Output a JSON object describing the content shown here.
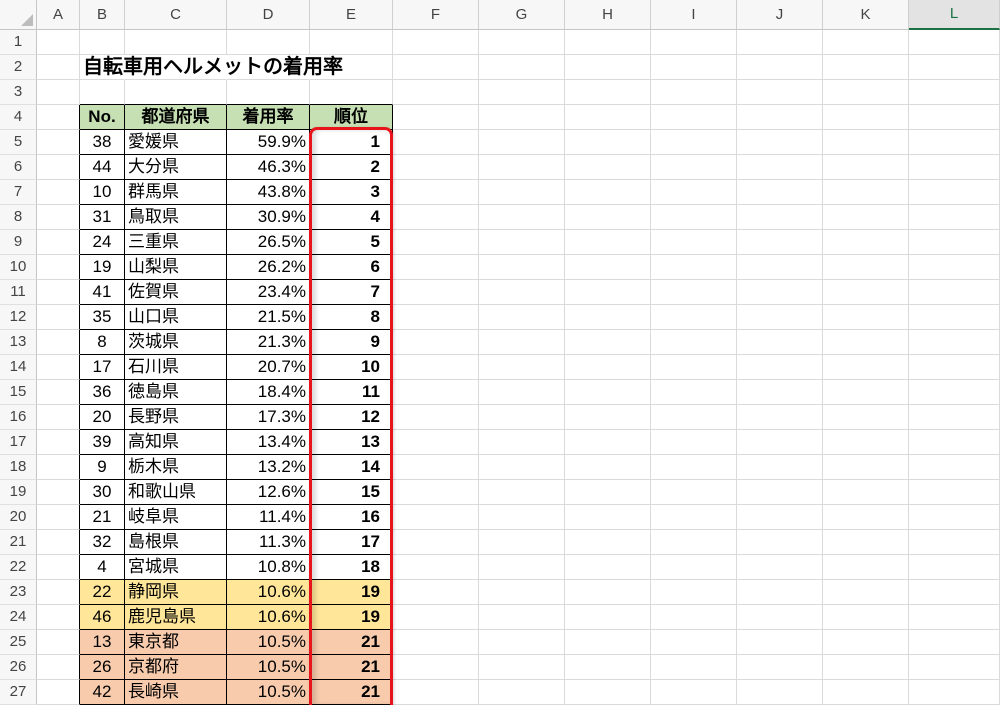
{
  "sheet": {
    "columns": [
      {
        "label": "A"
      },
      {
        "label": "B"
      },
      {
        "label": "C"
      },
      {
        "label": "D"
      },
      {
        "label": "E"
      },
      {
        "label": "F"
      },
      {
        "label": "G"
      },
      {
        "label": "H"
      },
      {
        "label": "I"
      },
      {
        "label": "J"
      },
      {
        "label": "K"
      },
      {
        "label": "L",
        "selected": true
      }
    ],
    "row_numbers": [
      1,
      2,
      3,
      4,
      5,
      6,
      7,
      8,
      9,
      10,
      11,
      12,
      13,
      14,
      15,
      16,
      17,
      18,
      19,
      20,
      21,
      22,
      23,
      24,
      25,
      26,
      27
    ],
    "title": "自転車用ヘルメットの着用率",
    "table": {
      "header": {
        "no": "No.",
        "prefecture": "都道府県",
        "rate": "着用率",
        "rank": "順位"
      },
      "rows": [
        {
          "no": 38,
          "prefecture": "愛媛県",
          "rate": "59.9%",
          "rank": 1
        },
        {
          "no": 44,
          "prefecture": "大分県",
          "rate": "46.3%",
          "rank": 2
        },
        {
          "no": 10,
          "prefecture": "群馬県",
          "rate": "43.8%",
          "rank": 3
        },
        {
          "no": 31,
          "prefecture": "鳥取県",
          "rate": "30.9%",
          "rank": 4
        },
        {
          "no": 24,
          "prefecture": "三重県",
          "rate": "26.5%",
          "rank": 5
        },
        {
          "no": 19,
          "prefecture": "山梨県",
          "rate": "26.2%",
          "rank": 6
        },
        {
          "no": 41,
          "prefecture": "佐賀県",
          "rate": "23.4%",
          "rank": 7
        },
        {
          "no": 35,
          "prefecture": "山口県",
          "rate": "21.5%",
          "rank": 8
        },
        {
          "no": 8,
          "prefecture": "茨城県",
          "rate": "21.3%",
          "rank": 9
        },
        {
          "no": 17,
          "prefecture": "石川県",
          "rate": "20.7%",
          "rank": 10
        },
        {
          "no": 36,
          "prefecture": "徳島県",
          "rate": "18.4%",
          "rank": 11
        },
        {
          "no": 20,
          "prefecture": "長野県",
          "rate": "17.3%",
          "rank": 12
        },
        {
          "no": 39,
          "prefecture": "高知県",
          "rate": "13.4%",
          "rank": 13
        },
        {
          "no": 9,
          "prefecture": "栃木県",
          "rate": "13.2%",
          "rank": 14
        },
        {
          "no": 30,
          "prefecture": "和歌山県",
          "rate": "12.6%",
          "rank": 15
        },
        {
          "no": 21,
          "prefecture": "岐阜県",
          "rate": "11.4%",
          "rank": 16
        },
        {
          "no": 32,
          "prefecture": "島根県",
          "rate": "11.3%",
          "rank": 17
        },
        {
          "no": 4,
          "prefecture": "宮城県",
          "rate": "10.8%",
          "rank": 18
        },
        {
          "no": 22,
          "prefecture": "静岡県",
          "rate": "10.6%",
          "rank": 19,
          "fill": "#FFE699"
        },
        {
          "no": 46,
          "prefecture": "鹿児島県",
          "rate": "10.6%",
          "rank": 19,
          "fill": "#FFE699"
        },
        {
          "no": 13,
          "prefecture": "東京都",
          "rate": "10.5%",
          "rank": 21,
          "fill": "#F8CBAD"
        },
        {
          "no": 26,
          "prefecture": "京都府",
          "rate": "10.5%",
          "rank": 21,
          "fill": "#F8CBAD"
        },
        {
          "no": 42,
          "prefecture": "長崎県",
          "rate": "10.5%",
          "rank": 21,
          "fill": "#F8CBAD"
        }
      ]
    }
  },
  "colors": {
    "header_fill": "#C6E0B4",
    "highlight_border": "#E8141C",
    "selection_accent": "#1E7145",
    "gridline": "#DADADA"
  }
}
